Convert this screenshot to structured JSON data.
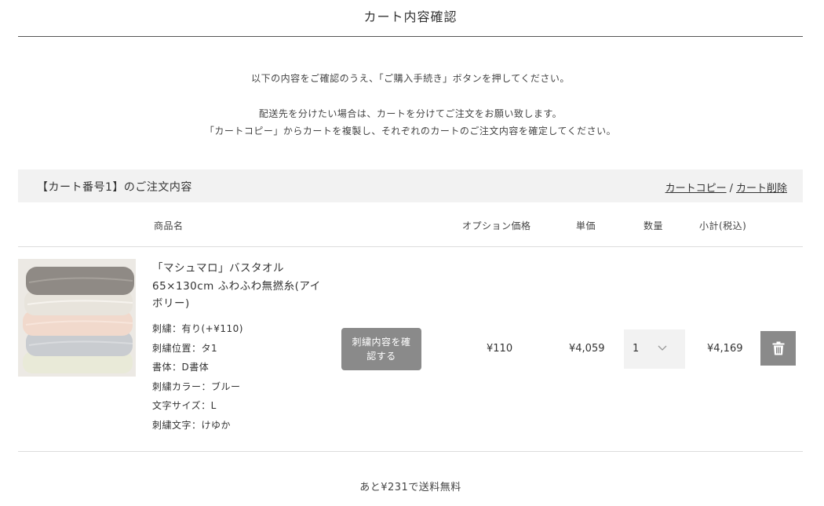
{
  "page": {
    "title": "カート内容確認"
  },
  "messages": {
    "line1": "以下の内容をご確認のうえ、「ご購入手続き」ボタンを押してください。",
    "line2": "配送先を分けたい場合は、カートを分けてご注文をお願い致します。",
    "line3": "「カートコピー」からカートを複製し、それぞれのカートのご注文内容を確定してください。"
  },
  "cart": {
    "title": "【カート番号1】のご注文内容",
    "copy_link": "カートコピー",
    "separator": "/",
    "delete_link": "カート削除"
  },
  "columns": {
    "name": "商品名",
    "option_price": "オプション価格",
    "unit_price": "単価",
    "quantity": "数量",
    "subtotal": "小計(税込)"
  },
  "item": {
    "name": "「マシュマロ」バスタオル 65×130cm ふわふわ無撚糸(アイボリー)",
    "attributes": [
      "刺繍：有り(+¥110)",
      "刺繍位置：タ1",
      "書体：D書体",
      "刺繍カラー：ブルー",
      "文字サイズ：L",
      "刺繍文字：けゆか"
    ],
    "confirm_button": "刺繍内容を確認する",
    "option_price": "¥110",
    "unit_price": "¥4,059",
    "quantity": "1",
    "subtotal": "¥4,169",
    "delete_icon": "trash-icon",
    "chevron_icon": "chevron-down-icon"
  },
  "free_shipping": "あと¥231で送料無料",
  "colors": {
    "button_gray": "#8a8a8a",
    "header_bg": "#f2f2f2",
    "text": "#333333"
  }
}
